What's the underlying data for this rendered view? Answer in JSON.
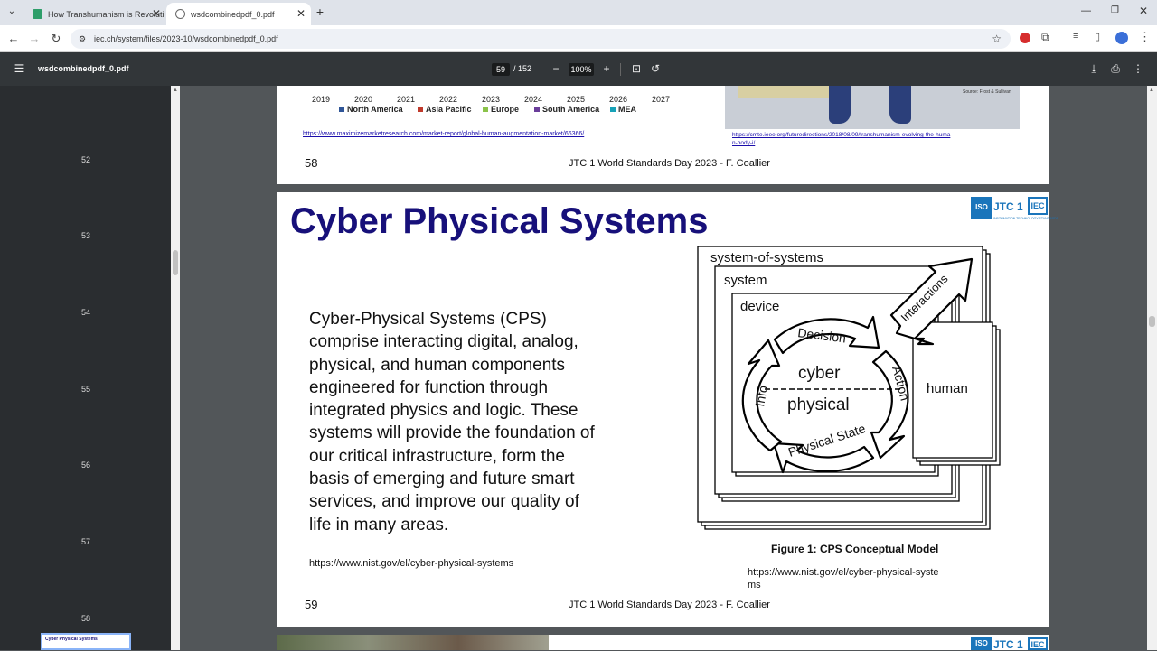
{
  "tabs": [
    {
      "title": "How Transhumanism is Revoluti",
      "active": false
    },
    {
      "title": "wsdcombinedpdf_0.pdf",
      "active": true
    }
  ],
  "address": {
    "url": "iec.ch/system/files/2023-10/wsdcombinedpdf_0.pdf"
  },
  "pdf_toolbar": {
    "filename": "wsdcombinedpdf_0.pdf",
    "current_page": "59",
    "total_pages": "/ 152",
    "zoom": "100%"
  },
  "sidebar": {
    "page_numbers": [
      "52",
      "53",
      "54",
      "55",
      "56",
      "57",
      "58"
    ],
    "thumb_title": "Cyber Physical Systems"
  },
  "prev_page": {
    "years": [
      "2019",
      "2020",
      "2021",
      "2022",
      "2023",
      "2024",
      "2025",
      "2026",
      "2027"
    ],
    "legend": [
      {
        "label": "North America",
        "color": "#2f5597"
      },
      {
        "label": "Asia Pacific",
        "color": "#c0392b"
      },
      {
        "label": "Europe",
        "color": "#8bc34a"
      },
      {
        "label": "South America",
        "color": "#6a3d9a"
      },
      {
        "label": "MEA",
        "color": "#17a2b8"
      }
    ],
    "link_left": "https://www.maximizemarketresearch.com/market-report/global-human-augmentation-market/66366/",
    "link_right_1": "https://cmte.ieee.org/futuredirections/2018/08/09/transhumanism-evolving-the-huma",
    "link_right_2": "n-body-i/",
    "source": "Source: Frost & Sullivan",
    "page_num": "58",
    "footer": "JTC 1 World Standards Day 2023 - F. Coallier"
  },
  "slide": {
    "title": "Cyber Physical Systems",
    "logo_iso": "ISO",
    "logo_jtc": "JTC 1",
    "logo_iec": "IEC",
    "logo_sub": "INFORMATION TECHNOLOGY STANDARDS",
    "body_lines": [
      "Cyber-Physical Systems (CPS)",
      "comprise interacting digital, analog,",
      "physical, and human components",
      "engineered for function through",
      "integrated physics and logic. These",
      "systems will provide the foundation of",
      "our critical infrastructure, form the",
      "basis of emerging and future smart",
      "services, and improve our quality of",
      "life in many areas."
    ],
    "link_left": "https://www.nist.gov/el/cyber-physical-systems",
    "diagram": {
      "sos": "system-of-systems",
      "system": "system",
      "device": "device",
      "decision": "Decision",
      "action": "Action",
      "info": "Info",
      "physical_state": "Physical State",
      "cyber": "cyber",
      "physical": "physical",
      "interactions": "Interactions",
      "human": "human"
    },
    "caption": "Figure 1: CPS Conceptual Model",
    "link_right_1": "https://www.nist.gov/el/cyber-physical-syste",
    "link_right_2": "ms",
    "page_num": "59",
    "footer": "JTC 1 World Standards Day 2023 - F. Coallier"
  },
  "colors": {
    "title_blue": "#17107a",
    "link_blue": "#1a0dab",
    "iso_blue": "#1a75bb"
  }
}
